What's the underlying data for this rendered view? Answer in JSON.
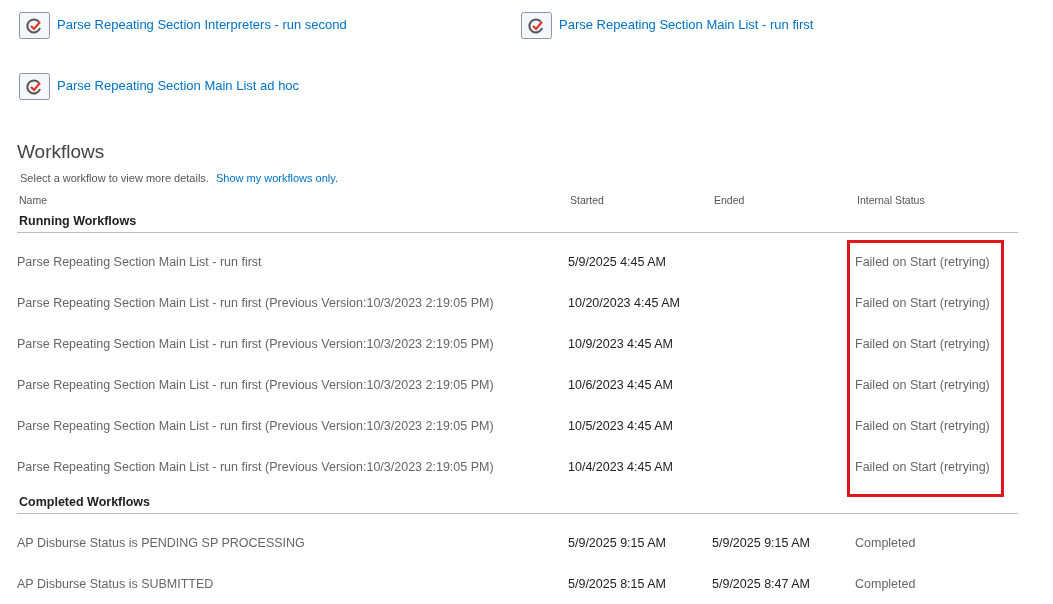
{
  "start_links": [
    {
      "label": "Parse Repeating Section Interpreters - run second"
    },
    {
      "label": "Parse Repeating Section Main List - run first"
    },
    {
      "label": "Parse Repeating Section Main List ad hoc"
    }
  ],
  "workflows": {
    "title": "Workflows",
    "hint": "Select a workflow to view more details.",
    "filter_link": "Show my workflows only.",
    "columns": [
      "Name",
      "Started",
      "Ended",
      "Internal Status"
    ],
    "groups": [
      {
        "title": "Running Workflows",
        "highlighted": true,
        "rows": [
          {
            "name": "Parse Repeating Section Main List - run first",
            "started": "5/9/2025 4:45 AM",
            "status": "Failed on Start (retrying)"
          },
          {
            "name": "Parse Repeating Section Main List - run first (Previous Version:10/3/2023 2:19:05 PM)",
            "started": "10/20/2023 4:45 AM",
            "status": "Failed on Start (retrying)"
          },
          {
            "name": "Parse Repeating Section Main List - run first (Previous Version:10/3/2023 2:19:05 PM)",
            "started": "10/9/2023 4:45 AM",
            "status": "Failed on Start (retrying)"
          },
          {
            "name": "Parse Repeating Section Main List - run first (Previous Version:10/3/2023 2:19:05 PM)",
            "started": "10/6/2023 4:45 AM",
            "status": "Failed on Start (retrying)"
          },
          {
            "name": "Parse Repeating Section Main List - run first (Previous Version:10/3/2023 2:19:05 PM)",
            "started": "10/5/2023 4:45 AM",
            "status": "Failed on Start (retrying)"
          },
          {
            "name": "Parse Repeating Section Main List - run first (Previous Version:10/3/2023 2:19:05 PM)",
            "started": "10/4/2023 4:45 AM",
            "status": "Failed on Start (retrying)"
          }
        ]
      },
      {
        "title": "Completed Workflows",
        "highlighted": false,
        "rows": [
          {
            "name": "AP Disburse Status is PENDING SP PROCESSING",
            "started": "5/9/2025 9:15 AM",
            "ended": "5/9/2025 9:15 AM",
            "status": "Completed"
          },
          {
            "name": "AP Disburse Status is SUBMITTED",
            "started": "5/9/2025 8:15 AM",
            "ended": "5/9/2025 8:47 AM",
            "status": "Completed"
          }
        ]
      }
    ]
  }
}
